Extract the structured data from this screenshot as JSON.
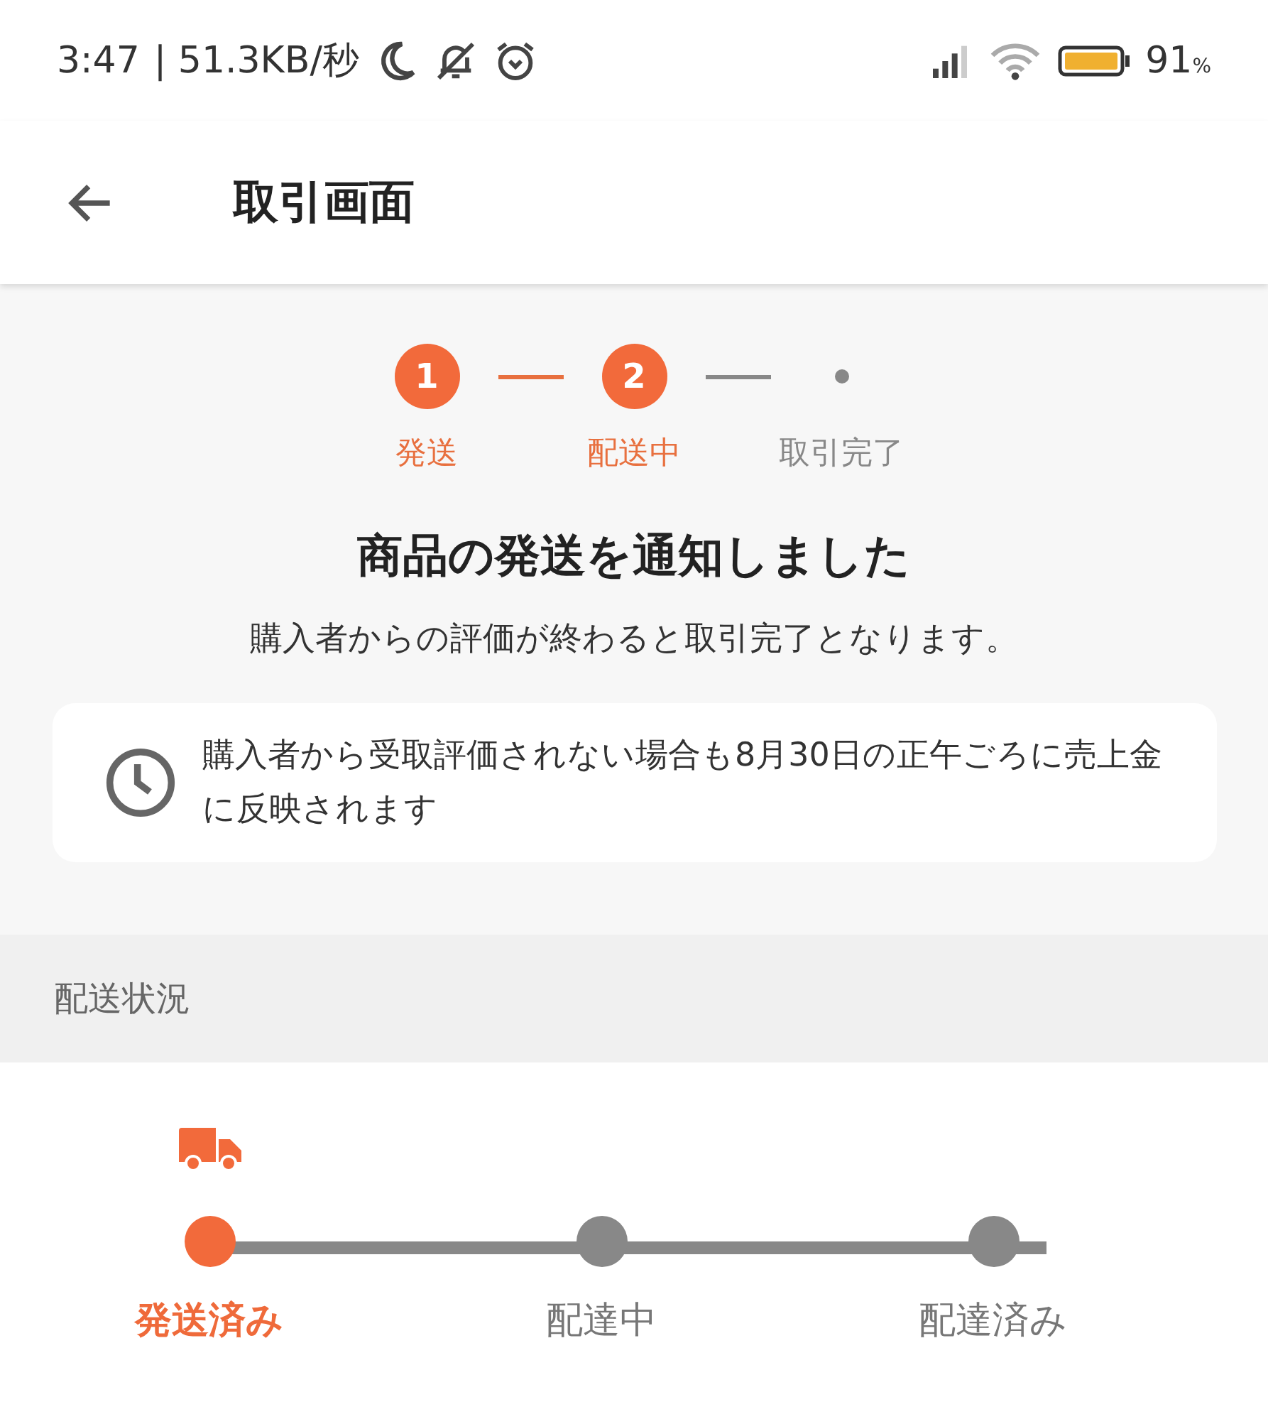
{
  "status_bar": {
    "time": "3:47",
    "speed": "| 51.3KB/秒",
    "battery": "91",
    "battery_unit": "%"
  },
  "header": {
    "title": "取引画面"
  },
  "steps": [
    {
      "number": "1",
      "label": "発送",
      "done": true
    },
    {
      "number": "2",
      "label": "配送中",
      "done": true
    },
    {
      "label": "取引完了",
      "done": false
    }
  ],
  "notice": {
    "title": "商品の発送を通知しました",
    "subtitle": "購入者からの評価が終わると取引完了となります。",
    "info": "購入者から受取評価されない場合も8月30日の正午ごろに売上金に反映されます"
  },
  "delivery": {
    "heading": "配送状況",
    "stops": [
      {
        "label": "発送済み",
        "selected": true
      },
      {
        "label": "配達中",
        "selected": false
      },
      {
        "label": "配達済み",
        "selected": false
      }
    ]
  }
}
